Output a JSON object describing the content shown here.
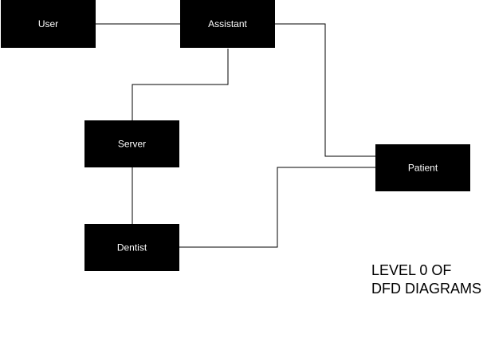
{
  "entities": {
    "user": "User",
    "assistant": "Assistant",
    "server": "Server",
    "dentist": "Dentist",
    "patient": "Patient"
  },
  "caption": "LEVEL 0 OF DFD DIAGRAMS",
  "colors": {
    "box_fill": "#000000",
    "box_text": "#ffffff",
    "line": "#000000",
    "background": "#ffffff"
  }
}
